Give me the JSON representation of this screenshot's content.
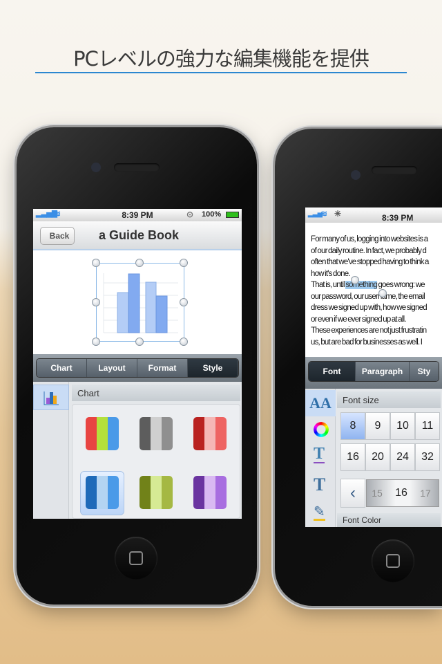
{
  "headline": "PCレベルの強力な編集機能を提供",
  "accent_color": "#2b87d0",
  "left_phone": {
    "status": {
      "time": "8:39 PM",
      "battery": "100%"
    },
    "nav": {
      "back_label": "Back",
      "title": "a Guide Book"
    },
    "tabs": [
      {
        "label": "Chart"
      },
      {
        "label": "Layout"
      },
      {
        "label": "Format"
      },
      {
        "label": "Style",
        "selected": true
      }
    ],
    "panel_header": "Chart",
    "sidebar_icon": "bar-chart-icon",
    "color_schemes": [
      {
        "colors": [
          "#e84442",
          "#b4e03c",
          "#4a9ae8"
        ]
      },
      {
        "colors": [
          "#5d5d5d",
          "#cfcfcf",
          "#8f8f8f"
        ]
      },
      {
        "colors": [
          "#b92220",
          "#f5b7b5",
          "#ee6462"
        ]
      },
      {
        "colors": [
          "#1e6ab9",
          "#b3d4f2",
          "#4a9ae8"
        ],
        "selected": true
      },
      {
        "colors": [
          "#718219",
          "#d6ea94",
          "#a5b843"
        ]
      },
      {
        "colors": [
          "#6a34a0",
          "#d9b9f2",
          "#a86ee0"
        ]
      }
    ]
  },
  "right_phone": {
    "status": {
      "time": "8:39 PM"
    },
    "document_lines": [
      "For many of us, logging into websites is a",
      "of our daily routine. In fact, we probably d",
      "often that we've stopped having to think a",
      "how it's done.",
      "That is, until |something| goes wrong: we",
      "our password, our username, the email",
      "dress we signed up with, how we signed",
      "or even if we ever signed up at all.",
      "These experiences are not just frustratin",
      "us, but are bad for businesses as well. I"
    ],
    "selected_word": "something",
    "line4_before": "That is, until ",
    "line4_after": " goes wrong: we",
    "tabs": [
      {
        "label": "Font",
        "selected": true
      },
      {
        "label": "Paragraph"
      },
      {
        "label": "Sty"
      }
    ],
    "sidebar_icons": [
      "font-size-icon",
      "color-wheel-icon",
      "underline-icon",
      "text-style-icon",
      "pen-icon"
    ],
    "font_size_header": "Font size",
    "font_sizes_row1": [
      "8",
      "9",
      "10",
      "11"
    ],
    "font_sizes_row2": [
      "16",
      "20",
      "24",
      "32"
    ],
    "selected_size": "8",
    "picker": {
      "prev": "15",
      "current": "16",
      "next": "17",
      "left_arrow": "‹"
    },
    "font_color_header": "Font Color"
  }
}
